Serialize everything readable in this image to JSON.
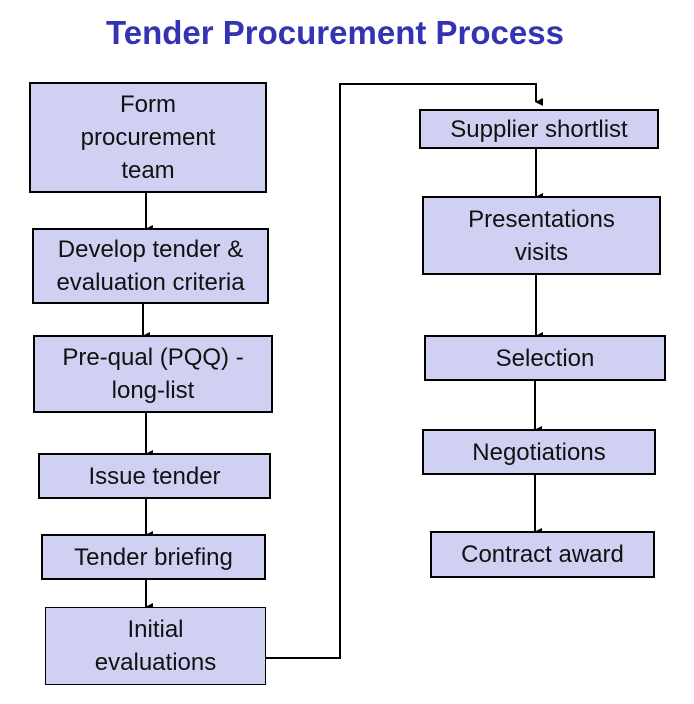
{
  "title": "Tender Procurement Process",
  "colors": {
    "title": "#3333b3",
    "box_fill": "#d0d0f3",
    "box_border": "#000000"
  },
  "steps": [
    {
      "label": "Form procurement team"
    },
    {
      "label": "Develop tender & evaluation criteria"
    },
    {
      "label": "Pre-qual (PQQ) - long-list"
    },
    {
      "label": "Issue tender"
    },
    {
      "label": "Tender briefing"
    },
    {
      "label": "Initial evaluations"
    },
    {
      "label": "Supplier shortlist"
    },
    {
      "label": "Presentations visits"
    },
    {
      "label": "Selection"
    },
    {
      "label": "Negotiations"
    },
    {
      "label": "Contract award"
    }
  ],
  "edges": [
    {
      "from": "Form procurement team",
      "to": "Develop tender & evaluation criteria"
    },
    {
      "from": "Develop tender & evaluation criteria",
      "to": "Pre-qual (PQQ) - long-list"
    },
    {
      "from": "Pre-qual (PQQ) - long-list",
      "to": "Issue tender"
    },
    {
      "from": "Issue tender",
      "to": "Tender briefing"
    },
    {
      "from": "Tender briefing",
      "to": "Initial evaluations"
    },
    {
      "from": "Initial evaluations",
      "to": "Supplier shortlist"
    },
    {
      "from": "Supplier shortlist",
      "to": "Presentations visits"
    },
    {
      "from": "Presentations visits",
      "to": "Selection"
    },
    {
      "from": "Selection",
      "to": "Negotiations"
    },
    {
      "from": "Negotiations",
      "to": "Contract award"
    }
  ]
}
